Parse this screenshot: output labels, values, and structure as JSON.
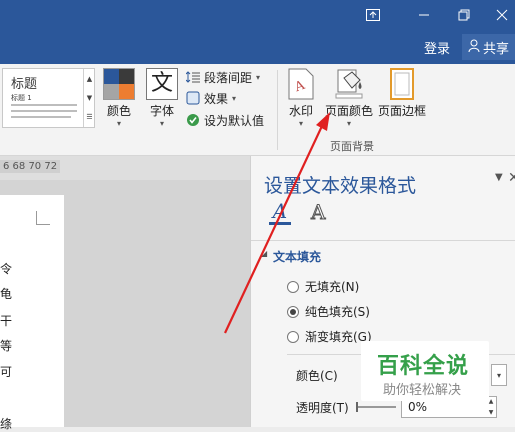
{
  "titlebar": {
    "login": "登录",
    "share": "共享"
  },
  "ribbon": {
    "style_gallery": {
      "title": "标题",
      "subtitle": "标题 1"
    },
    "colors_label": "颜色",
    "fonts_label": "字体",
    "fonts_glyph": "文",
    "paragraph_spacing": "段落间距",
    "effects": "效果",
    "set_default": "设为默认值",
    "watermark_label": "水印",
    "page_color_label": "页面颜色",
    "page_border_label": "页面边框",
    "page_background_group": "页面背景"
  },
  "ruler": {
    "numbers": "6 68 70 72"
  },
  "page_chars": [
    "令",
    "龟",
    "干",
    "等",
    "可",
    "绦"
  ],
  "pane": {
    "title": "设置文本效果格式",
    "text_fill_tab": "A",
    "text_outline_tab": "A",
    "section_title": "文本填充",
    "options": [
      {
        "label": "无填充(N)",
        "selected": false
      },
      {
        "label": "纯色填充(S)",
        "selected": true
      },
      {
        "label": "渐变填充(G)",
        "selected": false
      }
    ],
    "color_label": "颜色(C)",
    "transparency_label": "透明度(T)",
    "transparency_value": "0%"
  },
  "watermark_overlay": {
    "title": "百科全说",
    "subtitle": "助你轻松解决"
  },
  "colors": {
    "titlebar": "#2b579a",
    "arrow": "#e02020",
    "accent_blue": "#2b579a",
    "watermark_green": "#35a04a"
  }
}
